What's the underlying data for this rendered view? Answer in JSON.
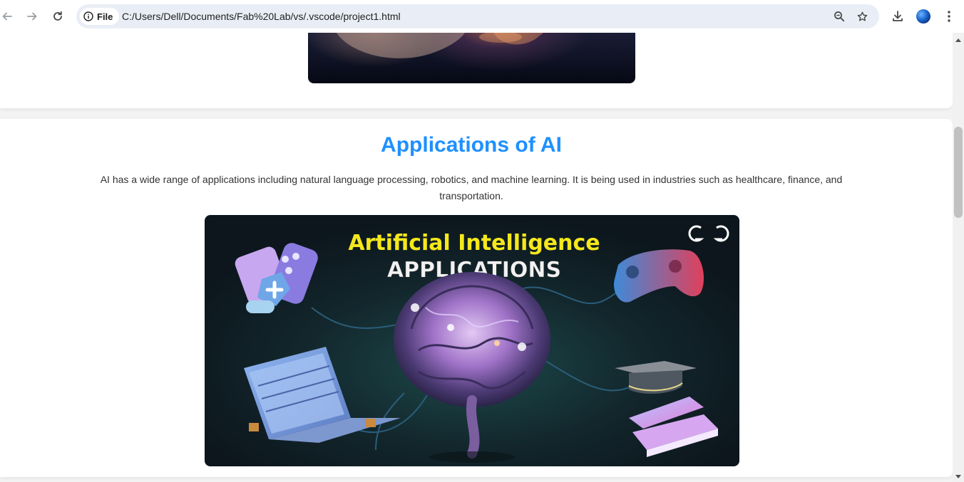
{
  "browser": {
    "site_chip_label": "File",
    "url": "C:/Users/Dell/Documents/Fab%20Lab/vs/.vscode/project1.html",
    "icons": [
      "back-arrow-icon",
      "forward-arrow-icon",
      "reload-icon",
      "info-icon",
      "zoom-icon",
      "star-icon",
      "download-icon",
      "profile-avatar",
      "kebab-menu-icon"
    ]
  },
  "section": {
    "title": "Applications of AI",
    "text": "AI has a wide range of applications including natural language processing, robotics, and machine learning. It is being used in industries such as healthcare, finance, and transportation.",
    "image": {
      "headline": "Artificial Intelligence",
      "subheadline": "APPLICATIONS",
      "logo": "GfG"
    }
  },
  "colors": {
    "title": "#1e90ff",
    "image_headline": "#f5e81b",
    "image_bg": "#0f1b22"
  }
}
